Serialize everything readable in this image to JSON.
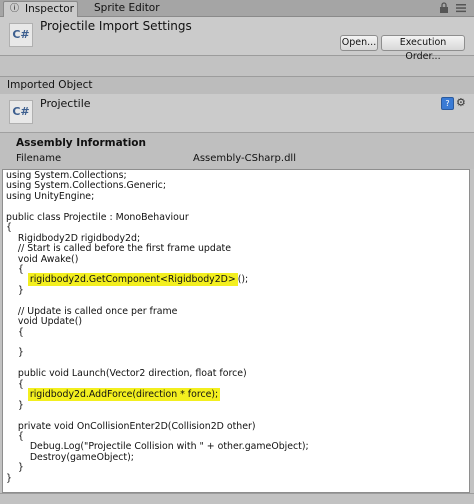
{
  "tabs": [
    {
      "label": "Inspector",
      "icon": "info-icon",
      "active": true
    },
    {
      "label": "Sprite Editor",
      "active": false
    }
  ],
  "header": {
    "icon_text": "C#",
    "title": "Projectile Import Settings",
    "open_label": "Open...",
    "execution_order_label": "Execution Order..."
  },
  "imported_object_label": "Imported Object",
  "object": {
    "icon_text": "C#",
    "name": "Projectile"
  },
  "assembly": {
    "title": "Assembly Information",
    "filename_label": "Filename",
    "filename_value": "Assembly-CSharp.dll"
  },
  "highlight_color": "#f3ef1f",
  "code": [
    {
      "text": "using System.Collections;"
    },
    {
      "text": "using System.Collections.Generic;"
    },
    {
      "text": "using UnityEngine;"
    },
    {
      "text": ""
    },
    {
      "text": "public class Projectile : MonoBehaviour"
    },
    {
      "text": "{"
    },
    {
      "text": "    Rigidbody2D rigidbody2d;"
    },
    {
      "text": "    // Start is called before the first frame update"
    },
    {
      "text": "    void Awake()"
    },
    {
      "text": "    {"
    },
    {
      "text": "",
      "indent": "        ",
      "hl": "rigidbody2d.GetComponent<Rigidbody2D>",
      "tail": "();"
    },
    {
      "text": "    }"
    },
    {
      "text": ""
    },
    {
      "text": "    // Update is called once per frame"
    },
    {
      "text": "    void Update()"
    },
    {
      "text": "    {"
    },
    {
      "text": ""
    },
    {
      "text": "    }"
    },
    {
      "text": ""
    },
    {
      "text": "    public void Launch(Vector2 direction, float force)"
    },
    {
      "text": "    {"
    },
    {
      "text": "",
      "indent": "        ",
      "hl": "rigidbody2d.AddForce(direction * force);",
      "tail": ""
    },
    {
      "text": "    }"
    },
    {
      "text": ""
    },
    {
      "text": "    private void OnCollisionEnter2D(Collision2D other)"
    },
    {
      "text": "    {"
    },
    {
      "text": "        Debug.Log(\"Projectile Collision with \" + other.gameObject);"
    },
    {
      "text": "        Destroy(gameObject);"
    },
    {
      "text": "    }"
    },
    {
      "text": "}"
    }
  ]
}
